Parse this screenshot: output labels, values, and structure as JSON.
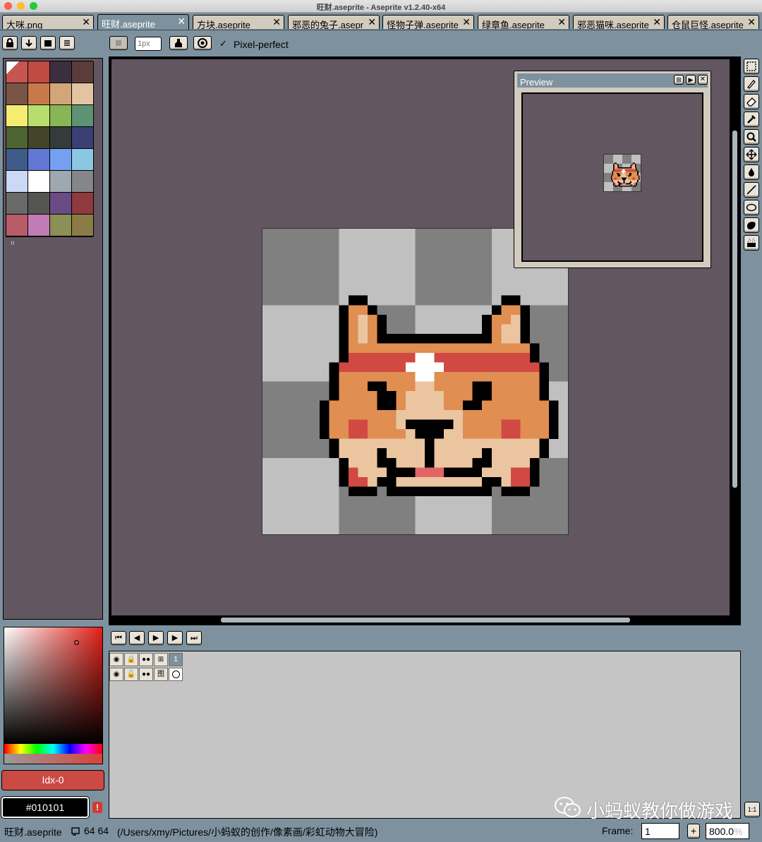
{
  "window": {
    "title": "旺财.aseprite - Aseprite v1.2.40-x64"
  },
  "tabs": [
    {
      "label": "大咪.png",
      "active": false
    },
    {
      "label": "旺财.aseprite",
      "active": true
    },
    {
      "label": "方块.aseprite",
      "active": false
    },
    {
      "label": "邪恶的兔子.asepr",
      "active": false
    },
    {
      "label": "怪物子弹.aseprite",
      "active": false
    },
    {
      "label": "绿章鱼.aseprite",
      "active": false
    },
    {
      "label": "邪恶猫咪.aseprite",
      "active": false
    },
    {
      "label": "仓鼠巨怪.aseprite",
      "active": false
    }
  ],
  "toolbar": {
    "brush_size_placeholder": "1px",
    "pixel_perfect_label": "Pixel-perfect",
    "pixel_perfect_checked": true
  },
  "palette": {
    "colors": [
      "#c65550",
      "#bf4b43",
      "#3b2f3f",
      "#5a3d38",
      "#7a5444",
      "#c8794a",
      "#d3a57a",
      "#e4c3a3",
      "#f4ed71",
      "#b6dd6d",
      "#87b656",
      "#5c9373",
      "#4d6432",
      "#44442a",
      "#353a3a",
      "#3b3f73",
      "#3f5b88",
      "#6178d5",
      "#73a1ef",
      "#8ac7e3",
      "#cad9f5",
      "#ffffff",
      "#9ea8b0",
      "#868688",
      "#686969",
      "#555552",
      "#6a4b83",
      "#8f3a3e",
      "#b75c68",
      "#c17bb5",
      "#8a9056",
      "#8b7c47"
    ],
    "page_marker": "ıı"
  },
  "preview": {
    "title": "Preview"
  },
  "color": {
    "index_label": "Idx-0",
    "hex_value": "#010101",
    "warning_mark": "!"
  },
  "timeline": {
    "frame_number": "1",
    "layer_name_icon": "图"
  },
  "status": {
    "filename": "旺财.aseprite",
    "size": "64 64",
    "path": "(/Users/xmy/Pictures/小蚂蚁的创作/像素画/彩虹动物大冒险)",
    "frame_label": "Frame:",
    "frame_value": "1",
    "plus_label": "+",
    "zoom_value": "800.0",
    "zoom_unit": "%"
  },
  "watermark": {
    "text": "小蚂蚁教你做游戏"
  },
  "corner_button": "1:1",
  "pixel_art": {
    "grid_width": 32,
    "rows": [
      "................................",
      "................................",
      "................................",
      "................................",
      ".........KK..............KK.....",
      "........KOOK............KOOK....",
      "........KOLOK..........KOOLK....",
      "........KOLOK..........KOLLK....",
      "........KOLOKKKKKKKKKKKKOLLK....",
      "........KOOOOOOOOOOOOOOOOOOOK....",
      "........KRRRRRRRWWRRRRRRRRRRK...",
      ".......KRRRRRRRWWWWRRRRRRRRRRK...",
      ".......KOOOOOOOOWWOOOOOOOOOOOK...",
      ".......KOOOKKOOOLLOOOOKKOOOOOK...",
      ".......KOOOOKKOLLLLOOOKKOOOOOK...",
      "......KOOOOOKKOLLLLOOKKOOOOOOOK..",
      "......KOOOOOOOLLLLLLLOOOOOOOOOK..",
      "......KOORROOOLKKKKKLOOOORROOOK..",
      "......KOORROOOOLKKKLLOOOORROOOK..",
      ".......KLLLLLLLLLKLLLLLLLLLLLK...",
      ".......KLLLLKLLLLKLLLLLKLLLLLK...",
      "........KLLLKKLLLKLLLLKKLLLLK....",
      "........KRLLLKKKPPPKKKKLLLRRK....",
      "........KRRLKKLLLLLLLLLKKLRRK....",
      ".........KKK.KKKKKKKKKKK.KKK.....",
      "................................"
    ],
    "palette": {
      "K": "#000000",
      "O": "#e08e51",
      "L": "#ebc5a0",
      "R": "#d04a43",
      "W": "#ffffff",
      "P": "#e06564"
    }
  }
}
